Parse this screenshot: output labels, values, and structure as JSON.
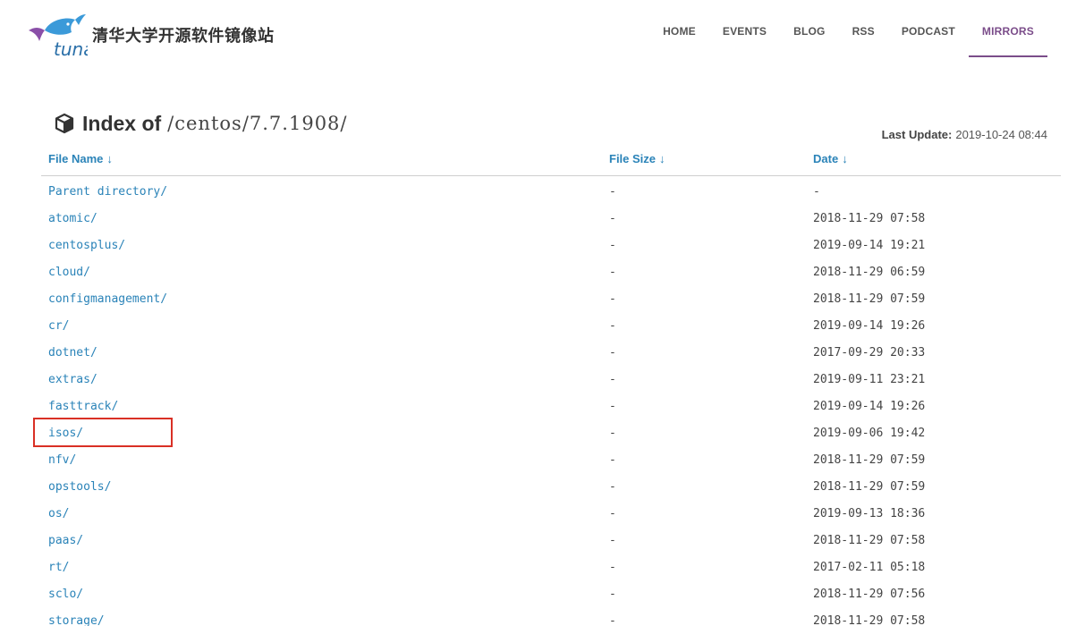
{
  "header": {
    "logo_text": "tuna",
    "site_title": "清华大学开源软件镜像站",
    "nav": [
      {
        "label": "HOME"
      },
      {
        "label": "EVENTS"
      },
      {
        "label": "BLOG"
      },
      {
        "label": "RSS"
      },
      {
        "label": "PODCAST"
      },
      {
        "label": "MIRRORS",
        "active": true
      }
    ]
  },
  "page": {
    "title_prefix": "Index of",
    "path": "/centos/7.7.1908/",
    "last_update_label": "Last Update:",
    "last_update_value": "2019-10-24 08:44"
  },
  "table": {
    "headers": {
      "name": "File Name",
      "size": "File Size",
      "date": "Date",
      "sort_arrow": "↓"
    },
    "rows": [
      {
        "name": "Parent directory/",
        "size": "-",
        "date": "-"
      },
      {
        "name": "atomic/",
        "size": "-",
        "date": "2018-11-29 07:58"
      },
      {
        "name": "centosplus/",
        "size": "-",
        "date": "2019-09-14 19:21"
      },
      {
        "name": "cloud/",
        "size": "-",
        "date": "2018-11-29 06:59"
      },
      {
        "name": "configmanagement/",
        "size": "-",
        "date": "2018-11-29 07:59"
      },
      {
        "name": "cr/",
        "size": "-",
        "date": "2019-09-14 19:26"
      },
      {
        "name": "dotnet/",
        "size": "-",
        "date": "2017-09-29 20:33"
      },
      {
        "name": "extras/",
        "size": "-",
        "date": "2019-09-11 23:21"
      },
      {
        "name": "fasttrack/",
        "size": "-",
        "date": "2019-09-14 19:26"
      },
      {
        "name": "isos/",
        "size": "-",
        "date": "2019-09-06 19:42",
        "highlighted": true
      },
      {
        "name": "nfv/",
        "size": "-",
        "date": "2018-11-29 07:59"
      },
      {
        "name": "opstools/",
        "size": "-",
        "date": "2018-11-29 07:59"
      },
      {
        "name": "os/",
        "size": "-",
        "date": "2019-09-13 18:36"
      },
      {
        "name": "paas/",
        "size": "-",
        "date": "2018-11-29 07:58"
      },
      {
        "name": "rt/",
        "size": "-",
        "date": "2017-02-11 05:18"
      },
      {
        "name": "sclo/",
        "size": "-",
        "date": "2018-11-29 07:56"
      },
      {
        "name": "storage/",
        "size": "-",
        "date": "2018-11-29 07:58"
      }
    ]
  },
  "colors": {
    "link": "#2a83b8",
    "accent": "#7b4d8a",
    "highlight": "#d93025"
  },
  "icons": {
    "logo": "tuna-fish-logo",
    "title": "cube-icon",
    "sort": "arrow-down-icon"
  }
}
